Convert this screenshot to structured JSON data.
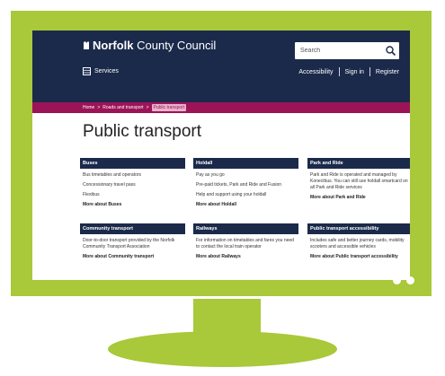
{
  "header": {
    "logo_bold": "Norfolk",
    "logo_rest": "County Council",
    "search_placeholder": "Search",
    "services_label": "Services",
    "links": [
      "Accessibility",
      "Sign in",
      "Register"
    ]
  },
  "breadcrumb": [
    "Home",
    "Roads and transport",
    "Public transport"
  ],
  "page_title": "Public transport",
  "cards": [
    {
      "title": "Buses",
      "lines": [
        "Bus timetables and operators",
        "Concessionary travel pass",
        "Flexibus"
      ],
      "more": "More about Buses"
    },
    {
      "title": "Holdall",
      "lines": [
        "Pay as you go",
        "Pre-paid tickets, Park and Ride and Fusion",
        "Help and support using your holdall"
      ],
      "more": "More about Holdall"
    },
    {
      "title": "Park and Ride",
      "lines": [
        "Park and Ride is operated and managed by Konectbus. You can still use holdall smartcard on all Park and Ride services"
      ],
      "more": "More about Park and Ride"
    },
    {
      "title": "Community transport",
      "lines": [
        "Door-to-door transport provided by the Norfolk Community Transport Association"
      ],
      "more": "More about Community transport"
    },
    {
      "title": "Railways",
      "lines": [
        "For information on timetables and fares you need to contact the local train operator"
      ],
      "more": "More about Railways"
    },
    {
      "title": "Public transport accessibility",
      "lines": [
        "Includes safe and better journey cards, mobility scooters and accessible vehicles"
      ],
      "more": "More about Public transport accessibility"
    }
  ],
  "colors": {
    "frame": "#a9c83a",
    "header_navy": "#1b2a4a",
    "breadcrumb_magenta": "#9c1458"
  }
}
